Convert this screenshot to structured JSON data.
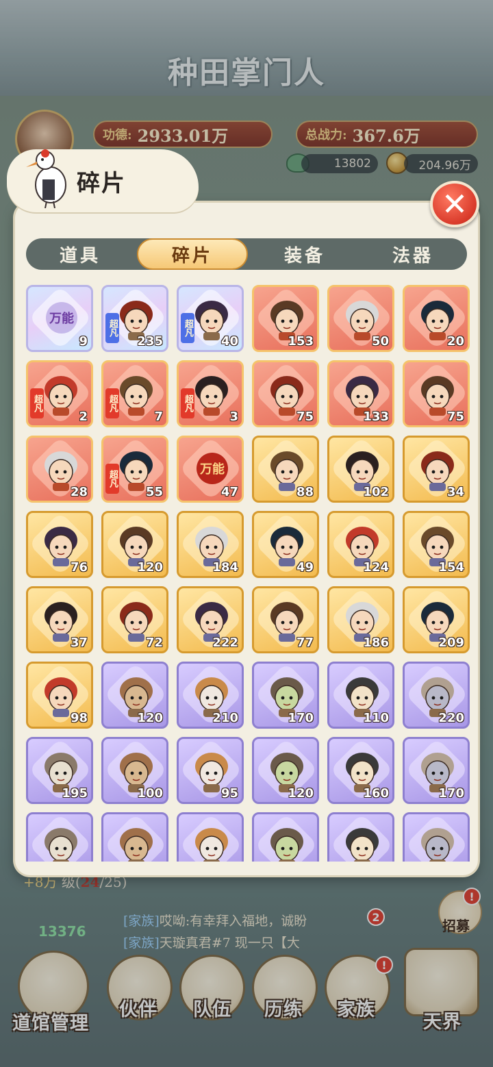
{
  "game": {
    "logo": "种田掌门人"
  },
  "stats": {
    "merit_label": "功德:",
    "merit_value": "2933.01万",
    "power_label": "总战力:",
    "power_value": "367.6万",
    "frog_value": "13802",
    "coin_value": "204.96万"
  },
  "panel": {
    "title": "碎片",
    "close_label": "✕"
  },
  "tabs": [
    {
      "label": "道具",
      "active": false
    },
    {
      "label": "碎片",
      "active": true
    },
    {
      "label": "装备",
      "active": false
    },
    {
      "label": "法器",
      "active": false
    }
  ],
  "fragments": [
    {
      "rarity": "universal",
      "count": "9",
      "universal_text": "万能",
      "tag": ""
    },
    {
      "rarity": "universal",
      "count": "235",
      "universal_text": "",
      "tag": "超凡"
    },
    {
      "rarity": "universal",
      "count": "40",
      "universal_text": "",
      "tag": "超凡"
    },
    {
      "rarity": "red",
      "count": "153",
      "universal_text": "",
      "tag": ""
    },
    {
      "rarity": "red",
      "count": "50",
      "universal_text": "",
      "tag": ""
    },
    {
      "rarity": "red",
      "count": "20",
      "universal_text": "",
      "tag": ""
    },
    {
      "rarity": "red",
      "count": "2",
      "universal_text": "",
      "tag": "超凡"
    },
    {
      "rarity": "red",
      "count": "7",
      "universal_text": "",
      "tag": "超凡"
    },
    {
      "rarity": "red",
      "count": "3",
      "universal_text": "",
      "tag": "超凡"
    },
    {
      "rarity": "red",
      "count": "75",
      "universal_text": "",
      "tag": ""
    },
    {
      "rarity": "red",
      "count": "133",
      "universal_text": "",
      "tag": ""
    },
    {
      "rarity": "red",
      "count": "75",
      "universal_text": "",
      "tag": ""
    },
    {
      "rarity": "red",
      "count": "28",
      "universal_text": "",
      "tag": ""
    },
    {
      "rarity": "red",
      "count": "55",
      "universal_text": "",
      "tag": "超凡"
    },
    {
      "rarity": "red",
      "count": "47",
      "universal_text": "万能",
      "tag": ""
    },
    {
      "rarity": "gold",
      "count": "88",
      "universal_text": "",
      "tag": ""
    },
    {
      "rarity": "gold",
      "count": "102",
      "universal_text": "",
      "tag": ""
    },
    {
      "rarity": "gold",
      "count": "34",
      "universal_text": "",
      "tag": ""
    },
    {
      "rarity": "gold",
      "count": "76",
      "universal_text": "",
      "tag": ""
    },
    {
      "rarity": "gold",
      "count": "120",
      "universal_text": "",
      "tag": ""
    },
    {
      "rarity": "gold",
      "count": "184",
      "universal_text": "",
      "tag": ""
    },
    {
      "rarity": "gold",
      "count": "49",
      "universal_text": "",
      "tag": ""
    },
    {
      "rarity": "gold",
      "count": "124",
      "universal_text": "",
      "tag": ""
    },
    {
      "rarity": "gold",
      "count": "154",
      "universal_text": "",
      "tag": ""
    },
    {
      "rarity": "gold",
      "count": "37",
      "universal_text": "",
      "tag": ""
    },
    {
      "rarity": "gold",
      "count": "72",
      "universal_text": "",
      "tag": ""
    },
    {
      "rarity": "gold",
      "count": "222",
      "universal_text": "",
      "tag": ""
    },
    {
      "rarity": "gold",
      "count": "77",
      "universal_text": "",
      "tag": ""
    },
    {
      "rarity": "gold",
      "count": "186",
      "universal_text": "",
      "tag": ""
    },
    {
      "rarity": "gold",
      "count": "209",
      "universal_text": "",
      "tag": ""
    },
    {
      "rarity": "gold",
      "count": "98",
      "universal_text": "",
      "tag": ""
    },
    {
      "rarity": "purple",
      "count": "120",
      "universal_text": "",
      "tag": ""
    },
    {
      "rarity": "purple",
      "count": "210",
      "universal_text": "",
      "tag": ""
    },
    {
      "rarity": "purple",
      "count": "170",
      "universal_text": "",
      "tag": ""
    },
    {
      "rarity": "purple",
      "count": "110",
      "universal_text": "",
      "tag": ""
    },
    {
      "rarity": "purple",
      "count": "220",
      "universal_text": "",
      "tag": ""
    },
    {
      "rarity": "purple",
      "count": "195",
      "universal_text": "",
      "tag": ""
    },
    {
      "rarity": "purple",
      "count": "100",
      "universal_text": "",
      "tag": ""
    },
    {
      "rarity": "purple",
      "count": "95",
      "universal_text": "",
      "tag": ""
    },
    {
      "rarity": "purple",
      "count": "120",
      "universal_text": "",
      "tag": ""
    },
    {
      "rarity": "purple",
      "count": "160",
      "universal_text": "",
      "tag": ""
    },
    {
      "rarity": "purple",
      "count": "170",
      "universal_text": "",
      "tag": ""
    },
    {
      "rarity": "purple",
      "count": "",
      "universal_text": "",
      "tag": ""
    },
    {
      "rarity": "purple",
      "count": "",
      "universal_text": "",
      "tag": ""
    },
    {
      "rarity": "purple",
      "count": "",
      "universal_text": "",
      "tag": ""
    },
    {
      "rarity": "purple",
      "count": "",
      "universal_text": "",
      "tag": ""
    },
    {
      "rarity": "purple",
      "count": "",
      "universal_text": "",
      "tag": ""
    },
    {
      "rarity": "purple",
      "count": "",
      "universal_text": "",
      "tag": ""
    }
  ],
  "background": {
    "level_prefix": "+8万",
    "level_text": "级(",
    "level_current": "24",
    "level_total": "/25)",
    "count": "13376",
    "chat": [
      {
        "channel": "[家族]",
        "text": "哎呦:有幸拜入福地，诚盼"
      },
      {
        "channel": "[家族]",
        "text": "天璇真君#7 现一只【大"
      }
    ],
    "chat_badge": "2",
    "recruit_label": "招募",
    "recruit_badge": "!"
  },
  "bottom_nav": [
    {
      "label": "道馆管理"
    },
    {
      "label": "伙伴"
    },
    {
      "label": "队伍"
    },
    {
      "label": "历练"
    },
    {
      "label": "家族"
    },
    {
      "label": "天界"
    }
  ],
  "colors": {
    "red_card": "#e8705c",
    "gold_card": "#f3bb4f",
    "purple_card": "#a897e6",
    "tab_active": "#f6c876",
    "panel_bg": "#f3efe2"
  }
}
